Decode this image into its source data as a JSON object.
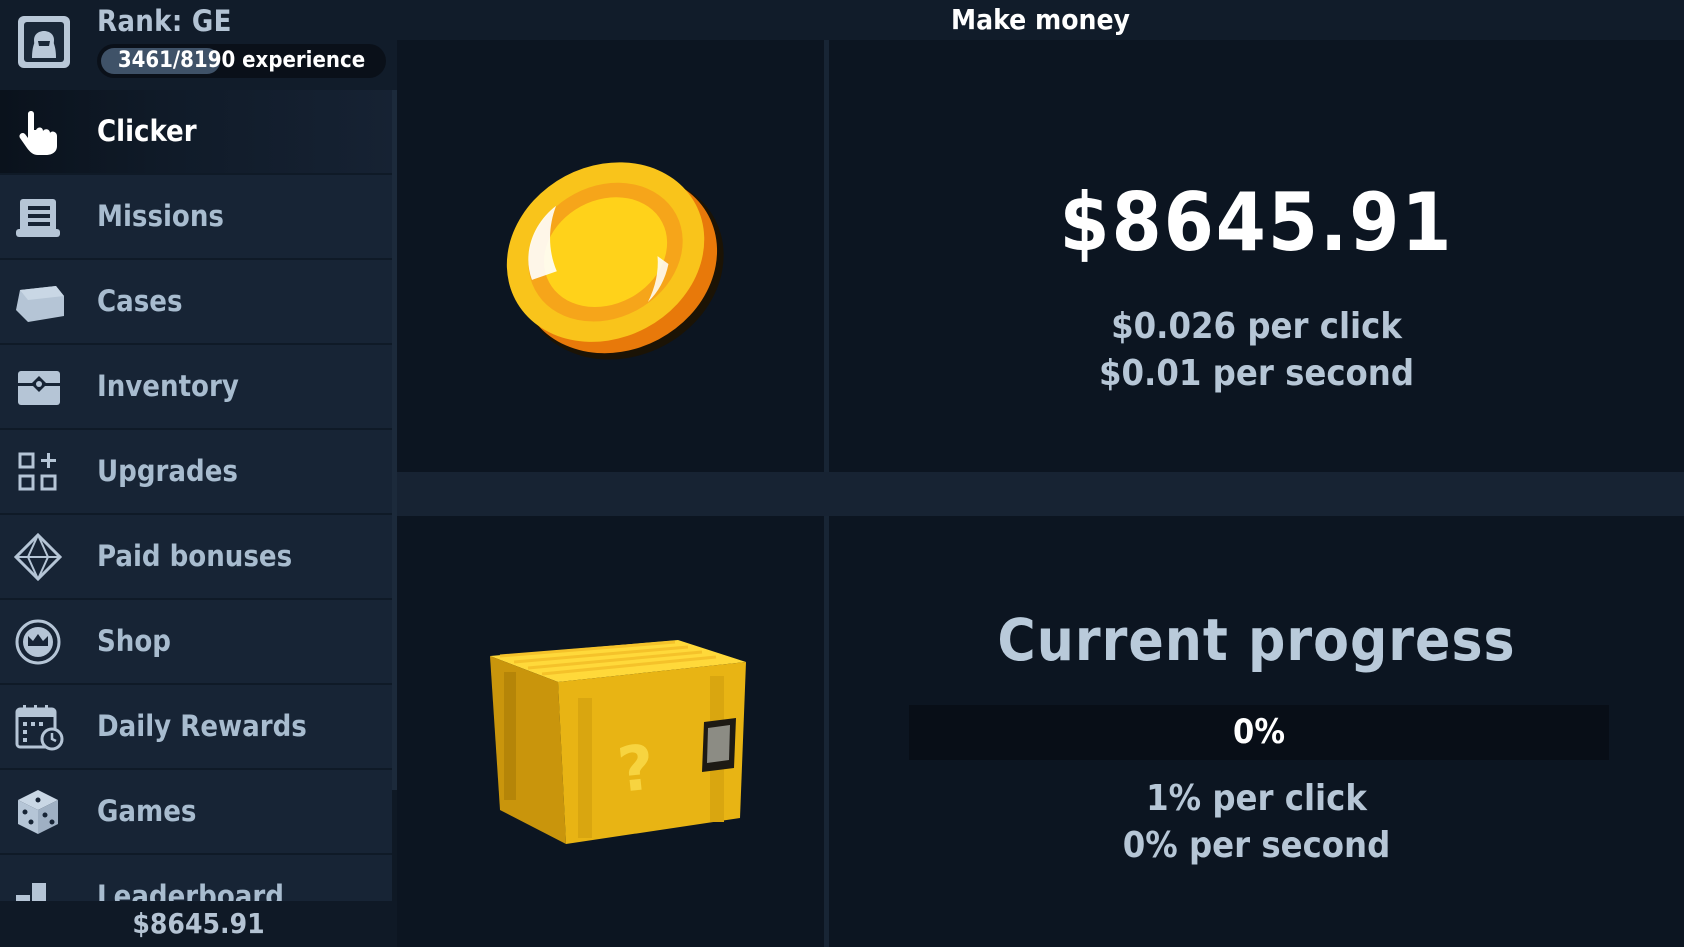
{
  "profile": {
    "rank_label": "Rank: GE",
    "experience_text": "3461/8190 experience",
    "experience_current": 3461,
    "experience_max": 8190,
    "avatar_icon": "avatar-icon"
  },
  "sidebar": {
    "items": [
      {
        "label": "Clicker",
        "icon": "pointer-hand-icon",
        "active": true
      },
      {
        "label": "Missions",
        "icon": "scroll-icon",
        "active": false
      },
      {
        "label": "Cases",
        "icon": "case-icon",
        "active": false
      },
      {
        "label": "Inventory",
        "icon": "inventory-chest-icon",
        "active": false
      },
      {
        "label": "Upgrades",
        "icon": "upgrades-grid-icon",
        "active": false
      },
      {
        "label": "Paid bonuses",
        "icon": "diamond-icon",
        "active": false
      },
      {
        "label": "Shop",
        "icon": "shop-crown-icon",
        "active": false
      },
      {
        "label": "Daily Rewards",
        "icon": "calendar-clock-icon",
        "active": false
      },
      {
        "label": "Games",
        "icon": "dice-icon",
        "active": false
      },
      {
        "label": "Leaderboard",
        "icon": "podium-icon",
        "active": false
      }
    ],
    "balance": "$8645.91"
  },
  "header": {
    "title": "Make money"
  },
  "money_panel": {
    "balance": "$8645.91",
    "per_click": "$0.026 per click",
    "per_second": "$0.01 per second"
  },
  "progress_panel": {
    "title": "Current progress",
    "percent_text": "0%",
    "percent_value": 0,
    "per_click": "1% per click",
    "per_second": "0% per second"
  },
  "colors": {
    "background": "#0c1521",
    "sidebar": "#162232",
    "coin_gold": "#f9c41b",
    "case_gold": "#e8b414",
    "label_text": "#a8bccf"
  }
}
